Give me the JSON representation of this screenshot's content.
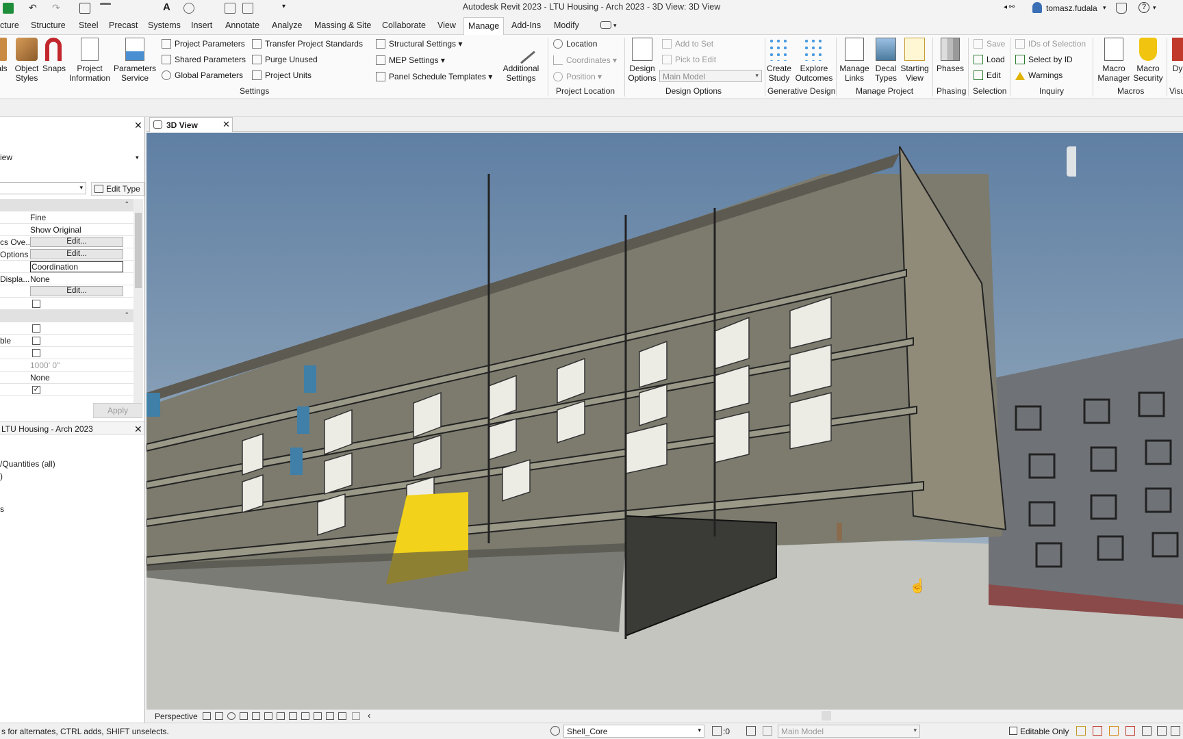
{
  "app": {
    "title": "Autodesk Revit 2023 - LTU Housing - Arch 2023 - 3D View: 3D View",
    "user": "tomasz.fudala"
  },
  "tabs": [
    "cture",
    "Structure",
    "Steel",
    "Precast",
    "Systems",
    "Insert",
    "Annotate",
    "Analyze",
    "Massing & Site",
    "Collaborate",
    "View",
    "Manage",
    "Add-Ins",
    "Modify"
  ],
  "active_tab": "Manage",
  "ribbon": {
    "settings_big": [
      "als",
      "Object Styles",
      "Snaps",
      "Project Information",
      "Parameters Service"
    ],
    "settings_small": [
      "Project  Parameters",
      "Shared  Parameters",
      "Global  Parameters",
      "Transfer  Project Standards",
      "Purge  Unused",
      "Project  Units",
      "Structural  Settings",
      "MEP  Settings",
      "Panel Schedule  Templates"
    ],
    "additional_settings": "Additional Settings",
    "location": [
      "Location",
      "Coordinates",
      "Position"
    ],
    "design_options": {
      "button": "Design Options",
      "add": "Add to Set",
      "pick": "Pick to Edit",
      "combo": "Main Model"
    },
    "generative": [
      "Create Study",
      "Explore Outcomes"
    ],
    "manage_project": [
      "Manage Links",
      "Decal Types",
      "Starting View"
    ],
    "phases": "Phases",
    "selection": [
      "Save",
      "Load",
      "Edit"
    ],
    "inquiry": [
      "IDs of  Selection",
      "Select  by ID",
      "Warnings"
    ],
    "macros": [
      "Macro Manager",
      "Macro Security"
    ],
    "cut": "Dy",
    "groups": [
      "Settings",
      "Project Location",
      "Design Options",
      "Generative Design",
      "Manage Project",
      "Phasing",
      "Selection",
      "Inquiry",
      "Macros",
      "Visu"
    ]
  },
  "properties": {
    "type_label": "iew",
    "edit_type": "Edit Type",
    "rows": [
      {
        "k": "",
        "v": "Fine"
      },
      {
        "k": "",
        "v": "Show Original"
      },
      {
        "k": "cs Ove...",
        "v": "Edit..."
      },
      {
        "k": "Options",
        "v": "Edit..."
      },
      {
        "k": "",
        "v": "Coordination"
      },
      {
        "k": "Displa...",
        "v": "None"
      },
      {
        "k": "",
        "v": "Edit..."
      },
      {
        "k": "",
        "v": ""
      },
      {
        "k": "",
        "v": ""
      },
      {
        "k": "ble",
        "v": ""
      },
      {
        "k": "",
        "v": ""
      },
      {
        "k": "",
        "v": "1000'  0\""
      },
      {
        "k": "",
        "v": "None"
      },
      {
        "k": "",
        "v": ""
      }
    ],
    "apply": "Apply"
  },
  "browser": {
    "title": "LTU Housing - Arch 2023",
    "items": [
      "/Quantities (all)",
      ")",
      "s"
    ]
  },
  "view_tab": "3D View",
  "view_bottom": {
    "mode": "Perspective"
  },
  "status": {
    "hint": "s for alternates, CTRL adds, SHIFT unselects.",
    "workset": "Shell_Core",
    "count": ":0",
    "model": "Main Model",
    "editable": "Editable Only"
  },
  "colors": {
    "ribbon_bg": "#fafafa",
    "sky": "#6d8bab",
    "accent_yellow": "#f2d21a",
    "brick": "#8a4a4a"
  }
}
